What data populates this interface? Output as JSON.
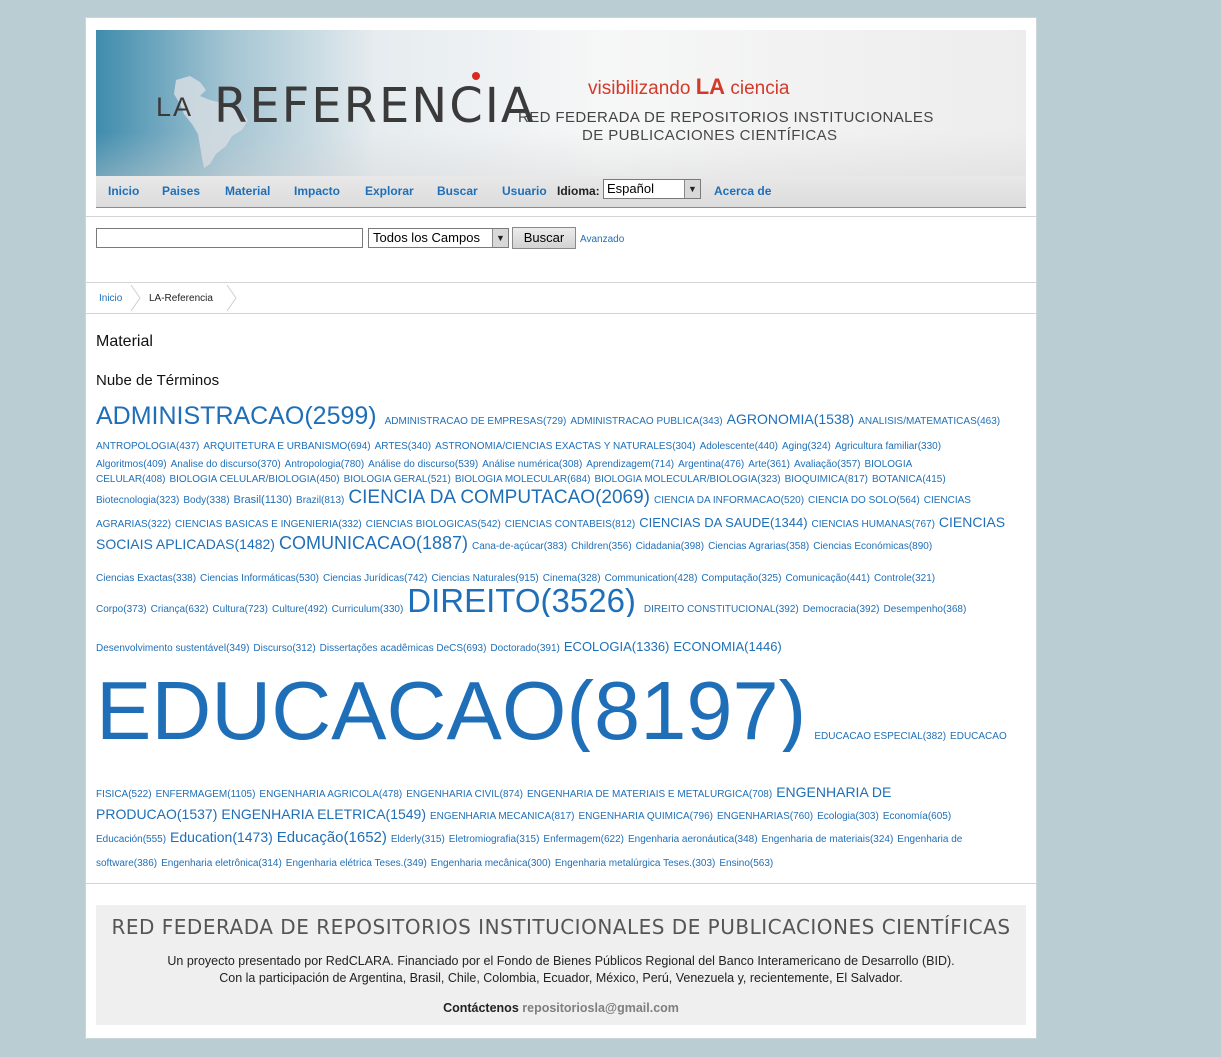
{
  "header": {
    "logo_prefix": "LA",
    "logo_name": "REFERENCIA",
    "tagline_pre": "visibilizando",
    "tagline_la": "LA",
    "tagline_post": "ciencia",
    "subtitle_line1": "RED FEDERADA DE REPOSITORIOS INSTITUCIONALES",
    "subtitle_line2": "DE PUBLICACIONES CIENTÍFICAS"
  },
  "nav": {
    "items": [
      "Inicio",
      "Paises",
      "Material",
      "Impacto",
      "Explorar",
      "Buscar",
      "Usuario"
    ],
    "idioma_label": "Idioma:",
    "language_value": "Español",
    "about": "Acerca de"
  },
  "search": {
    "query": "",
    "field_value": "Todos los Campos",
    "button": "Buscar",
    "advanced": "Avanzado"
  },
  "breadcrumb": [
    "Inicio",
    "LA-Referencia"
  ],
  "content": {
    "title": "Material",
    "cloud_title": "Nube de Términos"
  },
  "cloud_lines": [
    [
      [
        "ADMINISTRACAO(2599)",
        25
      ],
      [
        "ADMINISTRACAO DE EMPRESAS(729)",
        10
      ],
      [
        "ADMINISTRACAO PUBLICA(343)",
        10
      ],
      [
        "AGRONOMIA(1538)",
        14
      ],
      [
        "ANALISIS/MATEMATICAS(463)",
        10
      ]
    ],
    [
      [
        "ANTROPOLOGIA(437)",
        10
      ],
      [
        "ARQUITETURA E URBANISMO(694)",
        10
      ],
      [
        "ARTES(340)",
        10
      ],
      [
        "ASTRONOMIA/CIENCIAS EXACTAS Y NATURALES(304)",
        10
      ],
      [
        "Adolescente(440)",
        10
      ],
      [
        "Aging(324)",
        10
      ],
      [
        "Agricultura familiar(330)",
        10
      ]
    ],
    [
      [
        "Algoritmos(409)",
        10
      ],
      [
        "Analise do discurso(370)",
        10
      ],
      [
        "Antropologia(780)",
        10
      ],
      [
        "Análise do discurso(539)",
        10
      ],
      [
        "Análise numérica(308)",
        10
      ],
      [
        "Aprendizagem(714)",
        10
      ],
      [
        "Argentina(476)",
        10
      ],
      [
        "Arte(361)",
        10
      ],
      [
        "Avaliação(357)",
        10
      ],
      [
        "BIOLOGIA",
        10
      ]
    ],
    [
      [
        "CELULAR(408)",
        10
      ],
      [
        "BIOLOGIA CELULAR/BIOLOGIA(450)",
        10
      ],
      [
        "BIOLOGIA GERAL(521)",
        10
      ],
      [
        "BIOLOGIA MOLECULAR(684)",
        10
      ],
      [
        "BIOLOGIA MOLECULAR/BIOLOGIA(323)",
        10
      ],
      [
        "BIOQUIMICA(817)",
        10
      ],
      [
        "BOTANICA(415)",
        10
      ]
    ],
    [
      [
        "Biotecnologia(323)",
        10
      ],
      [
        "Body(338)",
        10
      ],
      [
        "Brasil(1130)",
        11
      ],
      [
        "Brazil(813)",
        10
      ],
      [
        "CIENCIA DA COMPUTACAO(2069)",
        19
      ],
      [
        "CIENCIA DA INFORMACAO(520)",
        10
      ],
      [
        "CIENCIA DO SOLO(564)",
        10
      ],
      [
        "CIENCIAS",
        10
      ]
    ],
    [
      [
        "AGRARIAS(322)",
        10
      ],
      [
        "CIENCIAS BASICAS E INGENIERIA(332)",
        10
      ],
      [
        "CIENCIAS BIOLOGICAS(542)",
        10
      ],
      [
        "CIENCIAS CONTABEIS(812)",
        10
      ],
      [
        "CIENCIAS DA SAUDE(1344)",
        13
      ],
      [
        "CIENCIAS HUMANAS(767)",
        10
      ],
      [
        "CIENCIAS",
        14
      ]
    ],
    [
      [
        "SOCIAIS APLICADAS(1482)",
        14
      ],
      [
        "COMUNICACAO(1887)",
        18
      ],
      [
        "Cana-de-açúcar(383)",
        10
      ],
      [
        "Children(356)",
        10
      ],
      [
        "Cidadania(398)",
        10
      ],
      [
        "Ciencias Agrarias(358)",
        10
      ],
      [
        "Ciencias Económicas(890)",
        10
      ]
    ],
    [
      [
        "Ciencias Exactas(338)",
        10
      ],
      [
        "Ciencias Informáticas(530)",
        10
      ],
      [
        "Ciencias Jurídicas(742)",
        10
      ],
      [
        "Ciencias Naturales(915)",
        10
      ],
      [
        "Cinema(328)",
        10
      ],
      [
        "Communication(428)",
        10
      ],
      [
        "Computação(325)",
        10
      ],
      [
        "Comunicação(441)",
        10
      ],
      [
        "Controle(321)",
        10
      ]
    ],
    [
      [
        "Corpo(373)",
        10
      ],
      [
        "Criança(632)",
        10
      ],
      [
        "Cultura(723)",
        10
      ],
      [
        "Culture(492)",
        10
      ],
      [
        "Curriculum(330)",
        10
      ],
      [
        "DIREITO(3526)",
        33
      ],
      [
        "DIREITO CONSTITUCIONAL(392)",
        10
      ],
      [
        "Democracia(392)",
        10
      ],
      [
        "Desempenho(368)",
        10
      ]
    ],
    [
      [
        "Desenvolvimento sustentável(349)",
        10
      ],
      [
        "Discurso(312)",
        10
      ],
      [
        "Dissertações acadêmicas DeCS(693)",
        10
      ],
      [
        "Doctorado(391)",
        10
      ],
      [
        "ECOLOGIA(1336)",
        13
      ],
      [
        "ECONOMIA(1446)",
        13
      ]
    ],
    [
      [
        "EDUCACAO(8197)",
        83
      ],
      [
        "EDUCACAO ESPECIAL(382)",
        10
      ],
      [
        "EDUCACAO",
        10
      ]
    ],
    [
      [
        "FISICA(522)",
        10
      ],
      [
        "ENFERMAGEM(1105)",
        10
      ],
      [
        "ENGENHARIA AGRICOLA(478)",
        10
      ],
      [
        "ENGENHARIA CIVIL(874)",
        10
      ],
      [
        "ENGENHARIA DE MATERIAIS E METALURGICA(708)",
        10
      ],
      [
        "ENGENHARIA DE",
        14
      ]
    ],
    [
      [
        "PRODUCAO(1537)",
        14
      ],
      [
        "ENGENHARIA ELETRICA(1549)",
        14
      ],
      [
        "ENGENHARIA MECANICA(817)",
        10
      ],
      [
        "ENGENHARIA QUIMICA(796)",
        10
      ],
      [
        "ENGENHARIAS(760)",
        10
      ],
      [
        "Ecologia(303)",
        10
      ],
      [
        "Economía(605)",
        10
      ]
    ],
    [
      [
        "Educación(555)",
        10
      ],
      [
        "Education(1473)",
        14
      ],
      [
        "Educação(1652)",
        15
      ],
      [
        "Elderly(315)",
        10
      ],
      [
        "Eletromiografia(315)",
        10
      ],
      [
        "Enfermagem(622)",
        10
      ],
      [
        "Engenharia aeronáutica(348)",
        10
      ],
      [
        "Engenharia de materiais(324)",
        10
      ],
      [
        "Engenharia de",
        10
      ]
    ],
    [
      [
        "software(386)",
        10
      ],
      [
        "Engenharia eletrônica(314)",
        10
      ],
      [
        "Engenharia elétrica Teses.(349)",
        10
      ],
      [
        "Engenharia mecânica(300)",
        10
      ],
      [
        "Engenharia metalúrgica Teses.(303)",
        10
      ],
      [
        "Ensino(563)",
        10
      ]
    ]
  ],
  "footer": {
    "title": "RED FEDERADA DE REPOSITORIOS INSTITUCIONALES DE PUBLICACIONES CIENTÍFICAS",
    "line1": "Un proyecto presentado por RedCLARA. Financiado por el Fondo de Bienes Públicos Regional del Banco Interamericano de Desarrollo (BID).",
    "line2": "Con la participación de Argentina, Brasil, Chile, Colombia, Ecuador, México, Perú, Venezuela y, recientemente, El Salvador.",
    "contact_label": "Contáctenos",
    "email": "repositoriosla@gmail.com"
  },
  "colors": {
    "link": "#1f6fb8",
    "accent_red": "#d43a2a",
    "background": "#b9cdd3"
  }
}
